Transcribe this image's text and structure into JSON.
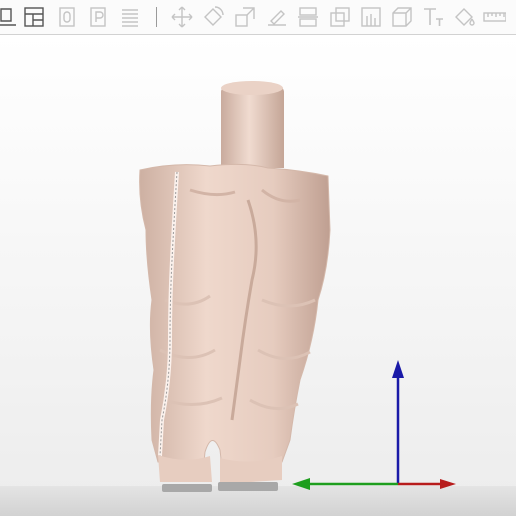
{
  "toolbar": {
    "tools": [
      {
        "name": "edit-icon"
      },
      {
        "name": "layout-icon"
      },
      {
        "name": "copy-object-icon"
      },
      {
        "name": "paste-object-icon"
      },
      {
        "name": "list-icon"
      },
      {
        "name": "move-icon"
      },
      {
        "name": "rotate-icon"
      },
      {
        "name": "scale-icon"
      },
      {
        "name": "lay-flat-icon"
      },
      {
        "name": "cut-icon"
      },
      {
        "name": "split-icon"
      },
      {
        "name": "support-icon"
      },
      {
        "name": "hollow-icon"
      },
      {
        "name": "text-icon"
      },
      {
        "name": "paint-icon"
      },
      {
        "name": "measure-icon"
      }
    ]
  },
  "viewport": {
    "model": "pants-model",
    "axes": {
      "x_color": "#b71c1c",
      "y_color": "#1e9e1e",
      "z_color": "#1a1aa8"
    },
    "model_color": "#e9cfc2",
    "plate_color": "#dcdcdc"
  }
}
